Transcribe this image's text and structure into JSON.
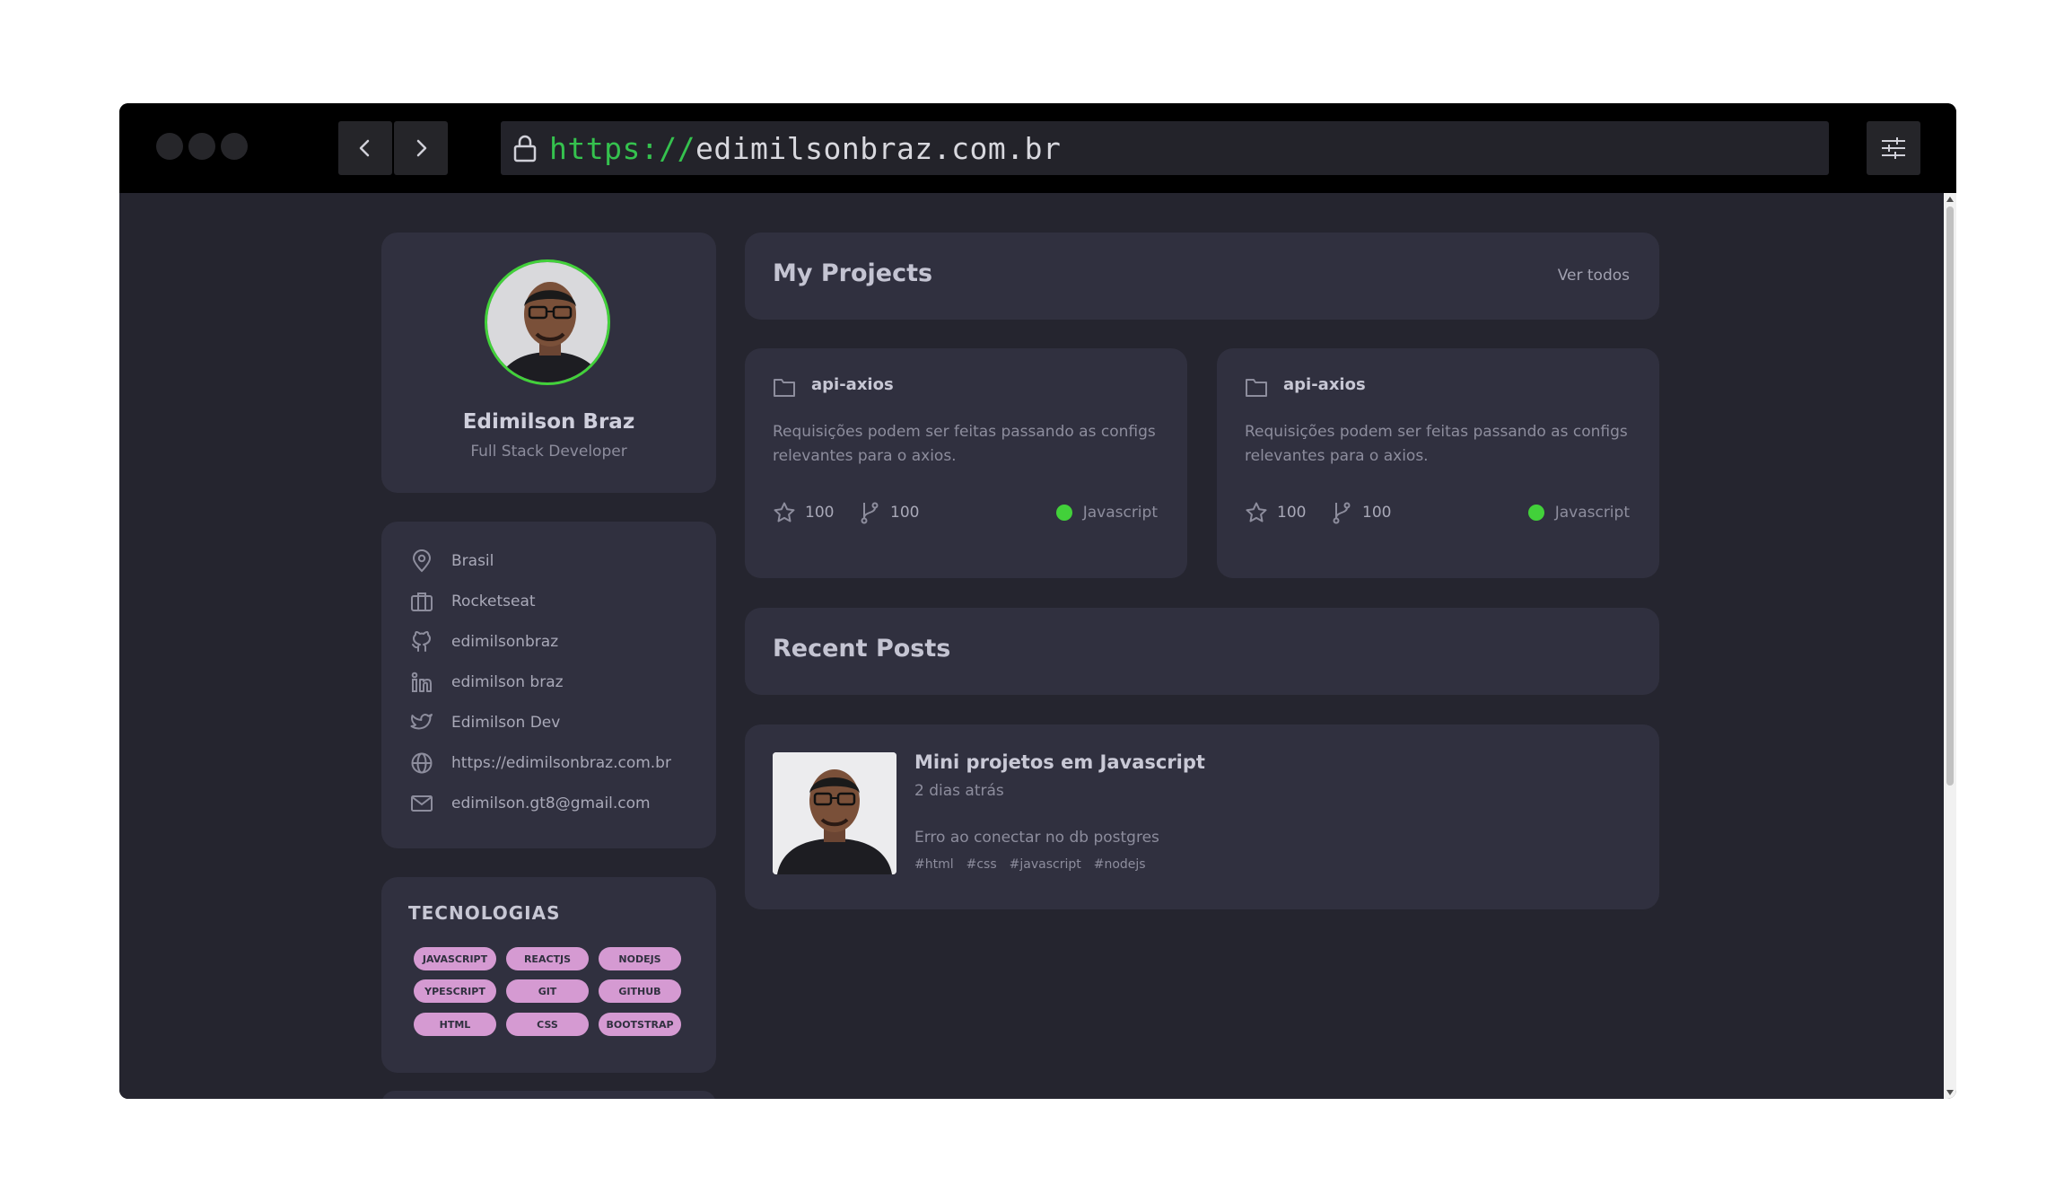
{
  "browser": {
    "url_protocol": "https://",
    "url_domain": "edimilsonbraz.com.br"
  },
  "profile": {
    "name": "Edimilson Braz",
    "role": "Full Stack Developer"
  },
  "info": [
    {
      "icon": "location-pin-icon",
      "text": "Brasil"
    },
    {
      "icon": "briefcase-icon",
      "text": "Rocketseat"
    },
    {
      "icon": "github-icon",
      "text": "edimilsonbraz"
    },
    {
      "icon": "linkedin-icon",
      "text": "edimilson braz"
    },
    {
      "icon": "twitter-icon",
      "text": "Edimilson Dev"
    },
    {
      "icon": "globe-icon",
      "text": "https://edimilsonbraz.com.br"
    },
    {
      "icon": "mail-icon",
      "text": "edimilson.gt8@gmail.com"
    }
  ],
  "tech": {
    "title": "TECNOLOGIAS",
    "tags": [
      "JAVASCRIPT",
      "REACTJS",
      "NODEJS",
      "YPESCRIPT",
      "GIT",
      "GITHUB",
      "HTML",
      "CSS",
      "BOOTSTRAP"
    ]
  },
  "projects": {
    "title": "My Projects",
    "see_all": "Ver todos",
    "items": [
      {
        "name": "api-axios",
        "description": "Requisições podem ser feitas passando as configs relevantes para o axios.",
        "stars": "100",
        "forks": "100",
        "language": "Javascript"
      },
      {
        "name": "api-axios",
        "description": "Requisições podem ser feitas passando as configs relevantes para o axios.",
        "stars": "100",
        "forks": "100",
        "language": "Javascript"
      }
    ]
  },
  "posts": {
    "title": "Recent Posts",
    "items": [
      {
        "title": "Mini projetos em Javascript",
        "date": "2 dias atrás",
        "excerpt": "Erro ao conectar no db postgres",
        "tags": [
          "#html",
          "#css",
          "#javascript",
          "#nodejs"
        ]
      }
    ]
  },
  "colors": {
    "background": "#25252f",
    "card": "#30303f",
    "accent_green": "#42d13a",
    "tag_pink": "#d59ad2",
    "url_protocol": "#35c24e"
  }
}
